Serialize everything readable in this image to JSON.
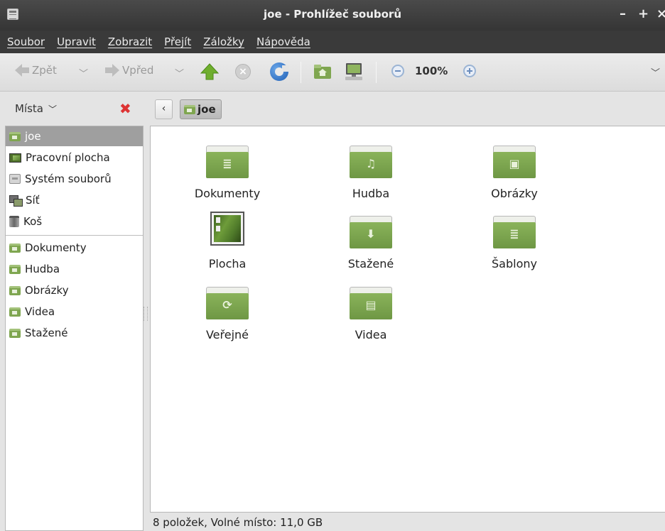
{
  "window": {
    "title": "joe - Prohlížeč souborů",
    "controls": {
      "minimize": "–",
      "maximize": "+",
      "close": "×"
    }
  },
  "menubar": {
    "items": [
      "Soubor",
      "Upravit",
      "Zobrazit",
      "Přejít",
      "Záložky",
      "Nápověda"
    ]
  },
  "toolbar": {
    "back_label": "Zpět",
    "forward_label": "Vpřed",
    "zoom_level": "100%",
    "icons": [
      "go-back-icon",
      "go-forward-icon",
      "go-up-icon",
      "stop-icon",
      "reload-icon",
      "home-icon",
      "computer-icon",
      "zoom-out-icon",
      "zoom-in-icon"
    ]
  },
  "places": {
    "header_label": "Místa",
    "items": [
      {
        "label": "joe",
        "icon": "home-folder-icon",
        "selected": true
      },
      {
        "label": "Pracovní plocha",
        "icon": "desktop-icon"
      },
      {
        "label": "Systém souborů",
        "icon": "drive-icon"
      },
      {
        "label": "Síť",
        "icon": "network-icon"
      },
      {
        "label": "Koš",
        "icon": "trash-icon"
      }
    ],
    "bookmarks": [
      {
        "label": "Dokumenty",
        "icon": "documents-folder-icon"
      },
      {
        "label": "Hudba",
        "icon": "music-folder-icon"
      },
      {
        "label": "Obrázky",
        "icon": "pictures-folder-icon"
      },
      {
        "label": "Videa",
        "icon": "videos-folder-icon"
      },
      {
        "label": "Stažené",
        "icon": "downloads-folder-icon"
      }
    ]
  },
  "pathbar": {
    "back": "‹",
    "crumb": "joe"
  },
  "files": [
    {
      "label": "Dokumenty",
      "glyph": "≣",
      "icon": "documents-folder-icon"
    },
    {
      "label": "Hudba",
      "glyph": "♫",
      "icon": "music-folder-icon"
    },
    {
      "label": "Obrázky",
      "glyph": "▣",
      "icon": "pictures-folder-icon"
    },
    {
      "label": "Plocha",
      "glyph": "",
      "icon": "desktop-folder-icon"
    },
    {
      "label": "Stažené",
      "glyph": "⬇",
      "icon": "downloads-folder-icon"
    },
    {
      "label": "Šablony",
      "glyph": "≣",
      "icon": "templates-folder-icon"
    },
    {
      "label": "Veřejné",
      "glyph": "⟳",
      "icon": "public-folder-icon"
    },
    {
      "label": "Videa",
      "glyph": "▤",
      "icon": "videos-folder-icon"
    }
  ],
  "status": {
    "text": "8 položek, Volné místo: 11,0 GB"
  },
  "colors": {
    "folder_green": "#7fa650",
    "selection": "#9f9f9f",
    "close_red": "#dd3333"
  }
}
